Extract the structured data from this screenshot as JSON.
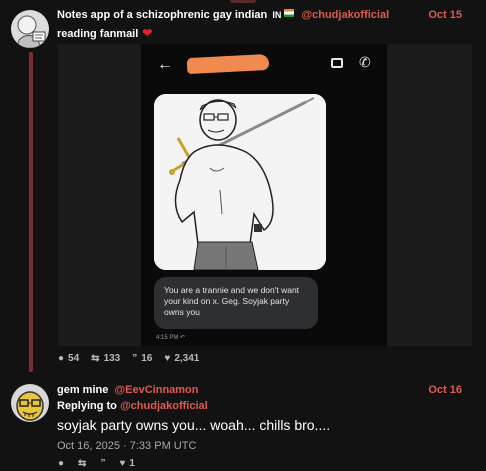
{
  "post1": {
    "author_name": "Notes app of a schizophrenic gay indian",
    "country_code": "IN",
    "handle": "@chudjakofficial",
    "date": "Oct 15",
    "text": "reading fanmail",
    "heart_glyph": "❤",
    "screenshot": {
      "back_icon": "arrow-left-icon",
      "video_icon": "video-call-icon",
      "phone_icon": "phone-icon",
      "message_text": "You are a trannie and we don't want your kind on x. Geg. Soyjak party owns you",
      "message_time": "4:15 PM"
    },
    "stats": {
      "replies": "54",
      "reposts": "133",
      "quotes": "16",
      "likes": "2,341"
    }
  },
  "post2": {
    "author_name": "gem mine",
    "handle": "@EevCinnamon",
    "date": "Oct 16",
    "replying_prefix": "Replying to",
    "replying_handle": "@chudjakofficial",
    "text": "soyjak party owns you... woah... chills bro....",
    "timestamp": "Oct 16, 2025 · 7:33 PM UTC",
    "stats": {
      "likes": "1"
    }
  },
  "colors": {
    "background": "#121212",
    "accent": "#e05a4f",
    "thread_line": "#7a2f2f",
    "redaction": "#f08a4e"
  }
}
